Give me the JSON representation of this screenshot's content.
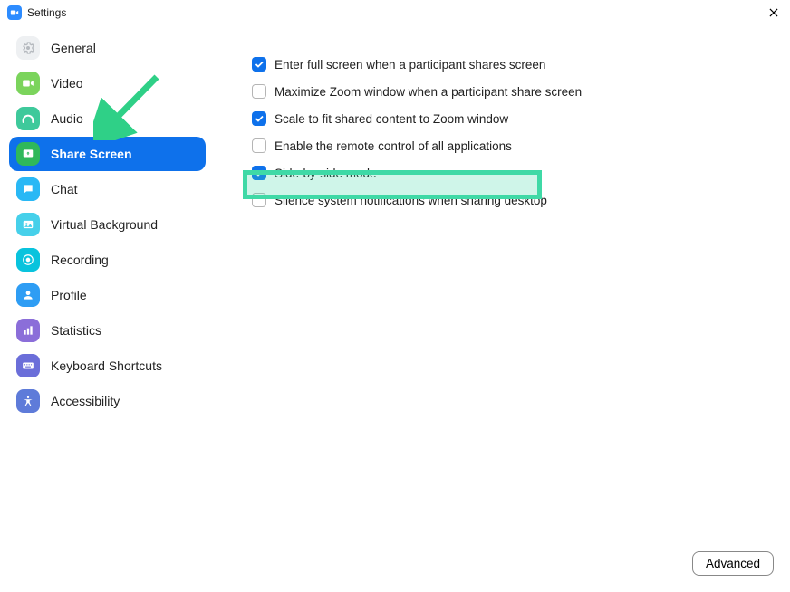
{
  "window": {
    "title": "Settings"
  },
  "sidebar": {
    "items": [
      {
        "label": "General"
      },
      {
        "label": "Video"
      },
      {
        "label": "Audio"
      },
      {
        "label": "Share Screen"
      },
      {
        "label": "Chat"
      },
      {
        "label": "Virtual Background"
      },
      {
        "label": "Recording"
      },
      {
        "label": "Profile"
      },
      {
        "label": "Statistics"
      },
      {
        "label": "Keyboard Shortcuts"
      },
      {
        "label": "Accessibility"
      }
    ],
    "active_index": 3
  },
  "options": [
    {
      "label": "Enter full screen when a participant shares screen",
      "checked": true
    },
    {
      "label": "Maximize Zoom window when a participant share screen",
      "checked": false
    },
    {
      "label": "Scale to fit shared content to Zoom window",
      "checked": true
    },
    {
      "label": "Enable the remote control of all applications",
      "checked": false
    },
    {
      "label": "Side-by-side mode",
      "checked": true
    },
    {
      "label": "Silence system notifications when sharing desktop",
      "checked": false
    }
  ],
  "buttons": {
    "advanced": "Advanced"
  },
  "colors": {
    "accent": "#0E71EB",
    "highlight": "#3FD9A6"
  }
}
